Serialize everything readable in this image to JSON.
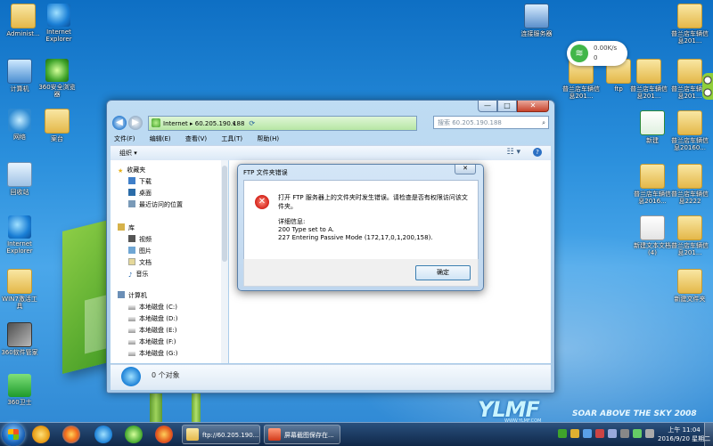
{
  "desktop": {
    "left_icons": [
      {
        "name": "admin-folder",
        "label": "Administ...",
        "kind": "folder"
      },
      {
        "name": "ie-shortcut",
        "label": "Internet Explorer",
        "kind": "ie"
      },
      {
        "name": "computer",
        "label": "计算机",
        "kind": "computer"
      },
      {
        "name": "browser-360",
        "label": "360安全浏览器",
        "kind": "ie360"
      },
      {
        "name": "network",
        "label": "网络",
        "kind": "network"
      },
      {
        "name": "folder-xiangmu",
        "label": "案台",
        "kind": "folder"
      },
      {
        "name": "recycle-bin",
        "label": "回收站",
        "kind": "trash"
      },
      {
        "name": "ie-shortcut-2",
        "label": "Internet Explorer",
        "kind": "ie"
      },
      {
        "name": "win7-folder",
        "label": "WIN7激活工具",
        "kind": "folder"
      },
      {
        "name": "box-app",
        "label": "360软件管家",
        "kind": "box"
      },
      {
        "name": "security-360",
        "label": "360卫士",
        "kind": "shield"
      }
    ],
    "right_icons": [
      {
        "name": "connect-server",
        "label": "连接服务器",
        "kind": "remote"
      },
      {
        "name": "folder-r1",
        "label": "普兰店车辆信息201...",
        "kind": "folder"
      },
      {
        "name": "folder-r2",
        "label": "普兰店车辆信息201...",
        "kind": "folder"
      },
      {
        "name": "folder-ftp",
        "label": "ftp",
        "kind": "folder"
      },
      {
        "name": "folder-r3",
        "label": "普兰店车辆信息201...",
        "kind": "folder"
      },
      {
        "name": "folder-r4",
        "label": "普兰店车辆信息201...",
        "kind": "folder"
      },
      {
        "name": "excel-file",
        "label": "新建",
        "kind": "excel"
      },
      {
        "name": "folder-r5",
        "label": "普兰店车辆信息20160...",
        "kind": "folder"
      },
      {
        "name": "folder-r6",
        "label": "普兰店车辆信息2016...",
        "kind": "folder"
      },
      {
        "name": "folder-r7",
        "label": "普兰店车辆信息2222",
        "kind": "folder"
      },
      {
        "name": "doc-r1",
        "label": "新建文本文档 (4)",
        "kind": "doc"
      },
      {
        "name": "folder-r8",
        "label": "普兰店车辆信息201...",
        "kind": "folder"
      },
      {
        "name": "folder-r9",
        "label": "新建文件夹",
        "kind": "folder"
      }
    ],
    "brand": {
      "logo": "YLMF",
      "tagline": "SOAR ABOVE THE SKY 2008",
      "site": "WWW.YLMF.COM"
    }
  },
  "net_widget": {
    "up": "0.00K/s",
    "down": "0"
  },
  "explorer": {
    "address": "Internet ▸ 60.205.190.188",
    "search_placeholder": "搜索 60.205.190.188",
    "menu": [
      "文件(F)",
      "编辑(E)",
      "查看(V)",
      "工具(T)",
      "帮助(H)"
    ],
    "organize": "组织 ▾",
    "nav": {
      "favorites": "收藏夹",
      "favorites_items": [
        "下载",
        "桌面",
        "最近访问的位置"
      ],
      "libraries": "库",
      "library_items": [
        "视频",
        "图片",
        "文档",
        "音乐"
      ],
      "computer": "计算机",
      "disks": [
        "本地磁盘 (C:)",
        "本地磁盘 (D:)",
        "本地磁盘 (E:)",
        "本地磁盘 (F:)",
        "本地磁盘 (G:)"
      ]
    },
    "details": "0 个对象"
  },
  "dialog": {
    "title": "FTP 文件夹错误",
    "message": "打开 FTP 服务器上的文件夹时发生错误。请检查是否有权限访问该文件夹。",
    "details_header": "详细信息:",
    "details_lines": [
      "200 Type set to A.",
      "227 Entering Passive Mode (172,17,0,1,200,158)."
    ],
    "ok": "确定",
    "close": "✕"
  },
  "taskbar": {
    "tasks": [
      "ftp://60.205.190....",
      "屏幕截图保存在..."
    ],
    "time": "上午 11:04",
    "date": "2016/9/20 星期二"
  },
  "colors": {
    "close_red": "#c8432c",
    "taskbar": "#0f2341",
    "desktop": "#2a8fdc"
  }
}
